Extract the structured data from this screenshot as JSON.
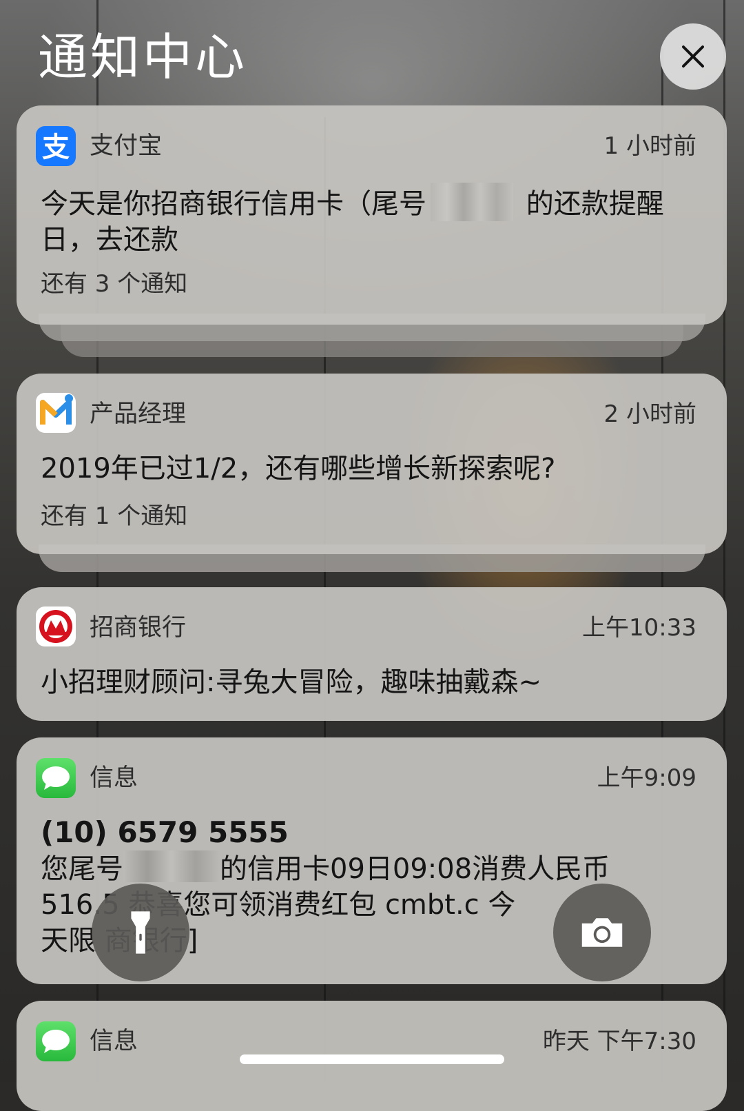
{
  "header": {
    "title": "通知中心"
  },
  "notifications": [
    {
      "app": "支付宝",
      "time": "1 小时前",
      "body_before": "今天是你招商银行信用卡（尾号",
      "body_after": " 的还款提醒日，去还款",
      "more": "还有 3 个通知",
      "icon": "alipay-icon",
      "icon_color": "#1677ff"
    },
    {
      "app": "产品经理",
      "time": "2 小时前",
      "body": "2019年已过1/2，还有哪些增长新探索呢?",
      "more": "还有 1 个通知",
      "icon": "product-manager-icon"
    },
    {
      "app": "招商银行",
      "time": "上午10:33",
      "body": "小招理财顾问:寻兔大冒险，趣味抽戴森~",
      "icon": "cmb-icon",
      "icon_color": "#d6121f"
    },
    {
      "app": "信息",
      "time": "上午9:09",
      "sender": "(10) 6579 5555",
      "line1_before": "您尾号",
      "line1_after": "的信用卡09日09:08消费人民币",
      "line2": "516.5   恭喜您可领消费红包 cmbt.c     今",
      "line3": "天限    商银行]",
      "icon": "messages-icon",
      "icon_color": "#35c759"
    },
    {
      "app": "信息",
      "time": "昨天 下午7:30",
      "icon": "messages-icon"
    }
  ],
  "controls": {
    "flashlight": "flashlight-icon",
    "camera": "camera-icon",
    "close": "close-icon"
  }
}
